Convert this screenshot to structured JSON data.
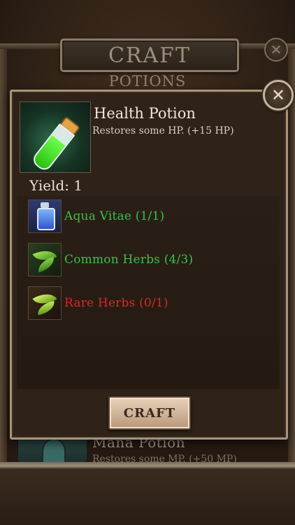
{
  "header": {
    "title": "CRAFT",
    "subtitle": "POTIONS"
  },
  "dialog": {
    "item_title": "Health Potion",
    "item_description": "Restores some HP. (+15 HP)",
    "yield": "Yield: 1",
    "ingredients": [
      {
        "label": "Aqua Vitae (1/1)",
        "status": "sufficient",
        "icon": "flask-icon"
      },
      {
        "label": "Common Herbs (4/3)",
        "status": "sufficient",
        "icon": "herb-icon"
      },
      {
        "label": "Rare Herbs (0/1)",
        "status": "insufficient",
        "icon": "rare-herb-icon"
      }
    ],
    "craft_button": "CRAFT"
  },
  "background_list": {
    "item_title": "Mana Potion",
    "item_description": "Restores some MP. (+50 MP)"
  },
  "colors": {
    "sufficient": "#35c24a",
    "insufficient": "#d82a1e",
    "frame": "#a89478"
  }
}
